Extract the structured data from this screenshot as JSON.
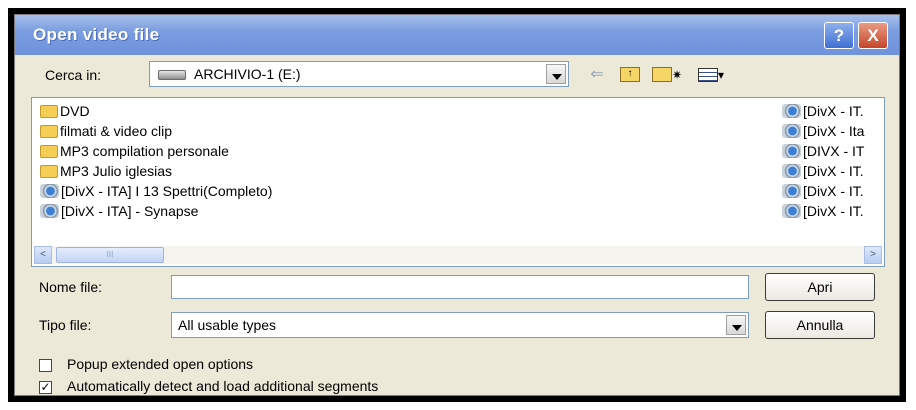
{
  "window": {
    "title": "Open video file",
    "help_label": "?",
    "close_label": "X"
  },
  "look_in": {
    "label": "Cerca in:",
    "value": "ARCHIVIO-1 (E:)",
    "drive_icon": "drive-icon"
  },
  "toolbar": {
    "back_icon": "back-arrow-icon",
    "up_icon": "up-folder-icon",
    "new_folder_icon": "new-folder-icon",
    "view_icon": "view-menu-icon",
    "view_caret": "▾"
  },
  "files_left": [
    {
      "name": "DVD",
      "type": "folder"
    },
    {
      "name": "filmati & video clip",
      "type": "folder"
    },
    {
      "name": "MP3 compilation personale",
      "type": "folder"
    },
    {
      "name": "MP3 Julio iglesias",
      "type": "folder"
    },
    {
      "name": "[DivX - ITA]  I 13 Spettri(Completo)",
      "type": "video"
    },
    {
      "name": "[DivX - ITA] - Synapse",
      "type": "video"
    }
  ],
  "files_right": [
    {
      "name": "[DivX - IT.",
      "type": "video"
    },
    {
      "name": "[DivX - Ita",
      "type": "video"
    },
    {
      "name": "[DIVX - IT",
      "type": "video"
    },
    {
      "name": "[DivX - IT.",
      "type": "video"
    },
    {
      "name": "[DivX - IT.",
      "type": "video"
    },
    {
      "name": "[DivX - IT.",
      "type": "video"
    }
  ],
  "scrollbar": {
    "left_arrow": "<",
    "right_arrow": ">",
    "thumb_grip": "III"
  },
  "file_name": {
    "label": "Nome file:",
    "value": ""
  },
  "file_type": {
    "label": "Tipo file:",
    "value": "All usable types"
  },
  "buttons": {
    "open": "Apri",
    "cancel": "Annulla"
  },
  "options": [
    {
      "label": "Popup extended open options",
      "checked": false
    },
    {
      "label": "Automatically detect and load additional segments",
      "checked": true
    }
  ],
  "checkmark": "✓"
}
